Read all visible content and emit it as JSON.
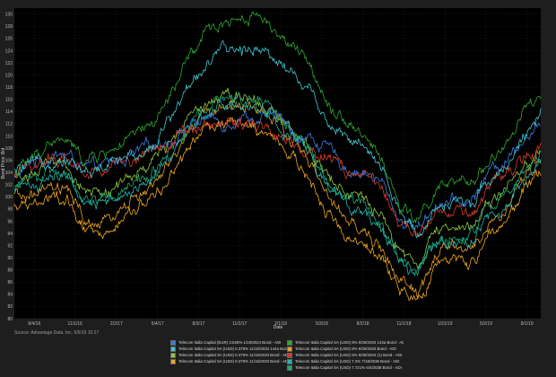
{
  "chart_data": {
    "type": "line",
    "title": "",
    "xlabel": "Date",
    "ylabel": "Bond Price: Bid",
    "source": "Source: Advantage Data, Inc. 9/5/19 10:27",
    "ylim": [
      80,
      131
    ],
    "yticks": [
      80,
      82,
      84,
      86,
      88,
      90,
      92,
      94,
      96,
      98,
      100,
      102,
      104,
      106,
      108,
      110,
      112,
      114,
      116,
      118,
      120,
      122,
      124,
      126,
      128,
      130
    ],
    "x_range": [
      0,
      100
    ],
    "xticks": [
      {
        "label": "8/4/16",
        "pos": 5.7
      },
      {
        "label": "11/1/16",
        "pos": 17.3
      },
      {
        "label": "2/2/17",
        "pos": 29.1
      },
      {
        "label": "5/4/17",
        "pos": 40.8
      },
      {
        "label": "8/3/17",
        "pos": 52.5
      },
      {
        "label": "11/2/17",
        "pos": 64.2
      },
      {
        "label": "2/1/18",
        "pos": 75.9
      },
      {
        "label": "5/3/18",
        "pos": 87.6
      },
      {
        "label": "8/2/18",
        "pos": 99.3
      },
      {
        "label": "11/1/18",
        "pos": 111.0
      },
      {
        "label": "1/31/19",
        "pos": 122.7
      },
      {
        "label": "5/2/19",
        "pos": 134.4
      },
      {
        "label": "8/1/19",
        "pos": 146.1
      }
    ],
    "x_count": 150,
    "series": [
      {
        "name": "Telecom Italia Capital (EUR) 3.625% 1/19/2024 Bond - ADI",
        "color": "#3b7de0",
        "points": [
          [
            0,
            103
          ],
          [
            5,
            106
          ],
          [
            10,
            106.5
          ],
          [
            15,
            107
          ],
          [
            20,
            104.5
          ],
          [
            25,
            105
          ],
          [
            30,
            106
          ],
          [
            35,
            107
          ],
          [
            40,
            109
          ],
          [
            45,
            109.5
          ],
          [
            50,
            112
          ],
          [
            55,
            113
          ],
          [
            60,
            112
          ],
          [
            65,
            113.5
          ],
          [
            70,
            112.5
          ],
          [
            75,
            113.5
          ],
          [
            80,
            110
          ],
          [
            85,
            109.5
          ],
          [
            90,
            107.5
          ],
          [
            95,
            104.5
          ],
          [
            100,
            104
          ],
          [
            105,
            102
          ],
          [
            110,
            96
          ],
          [
            115,
            95
          ],
          [
            120,
            99
          ],
          [
            125,
            99
          ],
          [
            130,
            99
          ],
          [
            135,
            104
          ],
          [
            140,
            106
          ],
          [
            145,
            110
          ],
          [
            150,
            111
          ]
        ]
      },
      {
        "name": "Telecom Italia Capital SA (USD) 6% 9/30/2034 144a Bond - ADI",
        "color": "#2ea82e",
        "points": [
          [
            0,
            104
          ],
          [
            5,
            106
          ],
          [
            10,
            109
          ],
          [
            15,
            109
          ],
          [
            20,
            106
          ],
          [
            25,
            107
          ],
          [
            30,
            108.5
          ],
          [
            35,
            110
          ],
          [
            40,
            112
          ],
          [
            45,
            117
          ],
          [
            50,
            123
          ],
          [
            55,
            127
          ],
          [
            60,
            129
          ],
          [
            65,
            129.5
          ],
          [
            70,
            130
          ],
          [
            75,
            127
          ],
          [
            80,
            124
          ],
          [
            85,
            121
          ],
          [
            90,
            115
          ],
          [
            95,
            112.5
          ],
          [
            100,
            110
          ],
          [
            105,
            106
          ],
          [
            110,
            98
          ],
          [
            115,
            96
          ],
          [
            120,
            101
          ],
          [
            125,
            102
          ],
          [
            130,
            102
          ],
          [
            135,
            106
          ],
          [
            140,
            108
          ],
          [
            145,
            114
          ],
          [
            150,
            116
          ]
        ]
      },
      {
        "name": "Telecom Italia Capital SA (USD) 6.375% 11/15/2033 144a Bond - ADI",
        "color": "#3ec8d2",
        "points": [
          [
            0,
            104
          ],
          [
            5,
            105
          ],
          [
            10,
            106
          ],
          [
            15,
            106.5
          ],
          [
            20,
            104
          ],
          [
            25,
            104.5
          ],
          [
            30,
            106
          ],
          [
            35,
            107
          ],
          [
            40,
            109
          ],
          [
            45,
            113.5
          ],
          [
            50,
            118.5
          ],
          [
            55,
            122
          ],
          [
            60,
            124
          ],
          [
            65,
            124
          ],
          [
            70,
            125
          ],
          [
            75,
            122.5
          ],
          [
            80,
            120
          ],
          [
            85,
            117
          ],
          [
            90,
            112
          ],
          [
            95,
            110
          ],
          [
            100,
            107.5
          ],
          [
            105,
            104
          ],
          [
            110,
            97
          ],
          [
            115,
            94
          ],
          [
            120,
            98.5
          ],
          [
            125,
            99
          ],
          [
            130,
            99
          ],
          [
            135,
            103
          ],
          [
            140,
            105
          ],
          [
            145,
            110
          ],
          [
            150,
            113
          ]
        ]
      },
      {
        "name": "Telecom Italia Capital SA (USD) 6% 9/30/2034 Bond - ADI",
        "color": "#e8a020",
        "points": [
          [
            0,
            100
          ],
          [
            5,
            100
          ],
          [
            10,
            101
          ],
          [
            15,
            101
          ],
          [
            20,
            96
          ],
          [
            25,
            95
          ],
          [
            30,
            98
          ],
          [
            35,
            100
          ],
          [
            40,
            102
          ],
          [
            45,
            105.5
          ],
          [
            50,
            111
          ],
          [
            55,
            114
          ],
          [
            60,
            115
          ],
          [
            65,
            115
          ],
          [
            70,
            114.5
          ],
          [
            75,
            111.5
          ],
          [
            80,
            109
          ],
          [
            85,
            105
          ],
          [
            90,
            99
          ],
          [
            95,
            96
          ],
          [
            100,
            94
          ],
          [
            105,
            91
          ],
          [
            110,
            86
          ],
          [
            115,
            84
          ],
          [
            120,
            90
          ],
          [
            125,
            92
          ],
          [
            130,
            91
          ],
          [
            135,
            95
          ],
          [
            140,
            98
          ],
          [
            145,
            103
          ],
          [
            150,
            106
          ]
        ]
      },
      {
        "name": "Telecom Italia Capital SA (USD) 6.375% 11/15/2033 Bond - ADI",
        "color": "#8ec63f",
        "points": [
          [
            0,
            103
          ],
          [
            5,
            104
          ],
          [
            10,
            105
          ],
          [
            15,
            105
          ],
          [
            20,
            101
          ],
          [
            25,
            100.5
          ],
          [
            30,
            102
          ],
          [
            35,
            103.5
          ],
          [
            40,
            106
          ],
          [
            45,
            109.5
          ],
          [
            50,
            114
          ],
          [
            55,
            116
          ],
          [
            60,
            117
          ],
          [
            65,
            117
          ],
          [
            70,
            116
          ],
          [
            75,
            113
          ],
          [
            80,
            111
          ],
          [
            85,
            108
          ],
          [
            90,
            103
          ],
          [
            95,
            101
          ],
          [
            100,
            99
          ],
          [
            105,
            96
          ],
          [
            110,
            91
          ],
          [
            115,
            89
          ],
          [
            120,
            94
          ],
          [
            125,
            95
          ],
          [
            130,
            95
          ],
          [
            135,
            99
          ],
          [
            140,
            101
          ],
          [
            145,
            105
          ],
          [
            150,
            108
          ]
        ]
      },
      {
        "name": "Telecom Italia Capital SA (USD) 6% 9/30/2034 (1) Bond - ADI",
        "color": "#d43a2a",
        "points": [
          [
            0,
            103
          ],
          [
            5,
            105.5
          ],
          [
            10,
            106
          ],
          [
            15,
            106.5
          ],
          [
            20,
            104
          ],
          [
            25,
            104.5
          ],
          [
            30,
            105.5
          ],
          [
            35,
            106.5
          ],
          [
            40,
            108.5
          ],
          [
            45,
            109
          ],
          [
            50,
            111.5
          ],
          [
            55,
            112
          ],
          [
            60,
            111.5
          ],
          [
            65,
            112
          ],
          [
            70,
            112
          ],
          [
            75,
            110.5
          ],
          [
            80,
            108.5
          ],
          [
            85,
            107.5
          ],
          [
            90,
            106.5
          ],
          [
            95,
            104
          ],
          [
            100,
            103.5
          ],
          [
            105,
            101
          ],
          [
            110,
            95
          ],
          [
            115,
            94
          ],
          [
            120,
            97
          ],
          [
            125,
            97
          ],
          [
            130,
            97
          ],
          [
            135,
            101
          ],
          [
            140,
            103
          ],
          [
            145,
            106
          ],
          [
            150,
            108
          ]
        ]
      },
      {
        "name": "Telecom Italia Capital SA (USD) 8.375% 11/15/2033 Bond - ADI",
        "color": "#f0a81e",
        "points": [
          [
            0,
            98
          ],
          [
            5,
            99
          ],
          [
            10,
            99.5
          ],
          [
            15,
            99
          ],
          [
            20,
            94
          ],
          [
            25,
            93
          ],
          [
            30,
            96
          ],
          [
            35,
            98
          ],
          [
            40,
            100
          ],
          [
            45,
            104
          ],
          [
            50,
            108
          ],
          [
            55,
            111.5
          ],
          [
            60,
            112.5
          ],
          [
            65,
            112
          ],
          [
            70,
            111
          ],
          [
            75,
            109
          ],
          [
            80,
            106
          ],
          [
            85,
            102
          ],
          [
            90,
            97
          ],
          [
            95,
            94
          ],
          [
            100,
            92
          ],
          [
            105,
            89
          ],
          [
            110,
            85
          ],
          [
            115,
            83
          ],
          [
            120,
            88
          ],
          [
            125,
            90
          ],
          [
            130,
            89
          ],
          [
            135,
            93
          ],
          [
            140,
            96
          ],
          [
            145,
            101
          ],
          [
            150,
            103
          ]
        ]
      },
      {
        "name": "Telecom Italia Capital SA (USD) 7.2% 7/18/2036 Bond - ADI",
        "color": "#1fb8b0",
        "points": [
          [
            0,
            101
          ],
          [
            5,
            102
          ],
          [
            10,
            103
          ],
          [
            15,
            103
          ],
          [
            20,
            99
          ],
          [
            25,
            98.5
          ],
          [
            30,
            100
          ],
          [
            35,
            101.5
          ],
          [
            40,
            104
          ],
          [
            45,
            107
          ],
          [
            50,
            111
          ],
          [
            55,
            114
          ],
          [
            60,
            115.5
          ],
          [
            65,
            115.5
          ],
          [
            70,
            115
          ],
          [
            75,
            112
          ],
          [
            80,
            110
          ],
          [
            85,
            106
          ],
          [
            90,
            101
          ],
          [
            95,
            99
          ],
          [
            100,
            97
          ],
          [
            105,
            94
          ],
          [
            110,
            89
          ],
          [
            115,
            87
          ],
          [
            120,
            92
          ],
          [
            125,
            93
          ],
          [
            130,
            93
          ],
          [
            135,
            97
          ],
          [
            140,
            99
          ],
          [
            145,
            103
          ],
          [
            150,
            106
          ]
        ]
      },
      {
        "name": "Telecom Italia Capital SA (USD) 7.721% 6/4/2038 Bond - ADI",
        "color": "#1eaa78",
        "points": [
          [
            0,
            102
          ],
          [
            5,
            103
          ],
          [
            10,
            104
          ],
          [
            15,
            104
          ],
          [
            20,
            100
          ],
          [
            25,
            99.5
          ],
          [
            30,
            101
          ],
          [
            35,
            102.5
          ],
          [
            40,
            105
          ],
          [
            45,
            108
          ],
          [
            50,
            112
          ],
          [
            55,
            115
          ],
          [
            60,
            116
          ],
          [
            65,
            116
          ],
          [
            70,
            115.5
          ],
          [
            75,
            112.5
          ],
          [
            80,
            110.5
          ],
          [
            85,
            107
          ],
          [
            90,
            102
          ],
          [
            95,
            100
          ],
          [
            100,
            98
          ],
          [
            105,
            95
          ],
          [
            110,
            90
          ],
          [
            115,
            88
          ],
          [
            120,
            93
          ],
          [
            125,
            94
          ],
          [
            130,
            94
          ],
          [
            135,
            98
          ],
          [
            140,
            100
          ],
          [
            145,
            104
          ],
          [
            150,
            107
          ]
        ]
      }
    ]
  },
  "legend_order": [
    0,
    1,
    2,
    3,
    4,
    5,
    6,
    7,
    8
  ]
}
